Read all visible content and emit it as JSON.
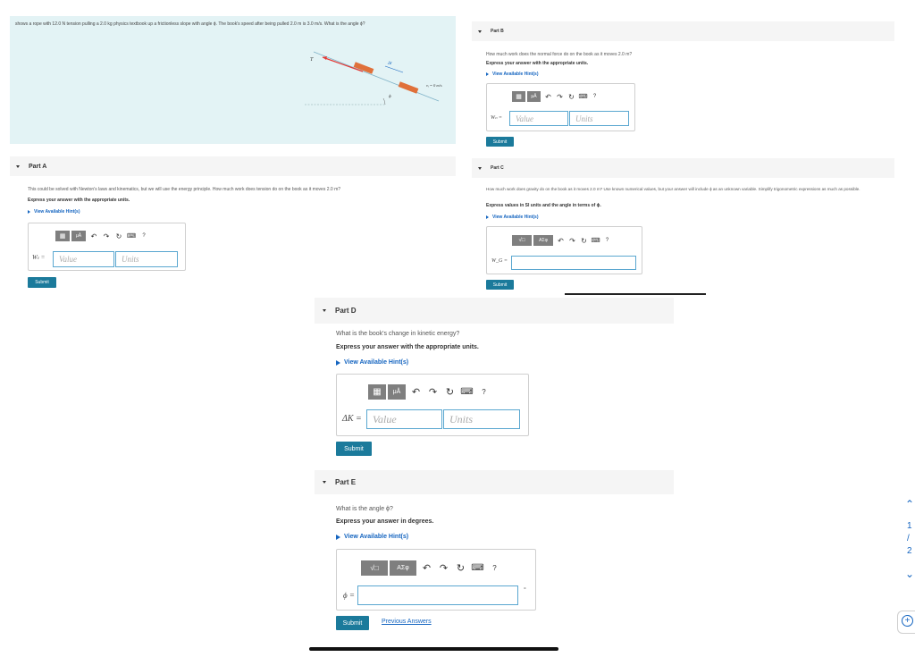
{
  "problem": {
    "text": "shows a rope with 12.0 N tension pulling a 2.0 kg physics textbook up a frictionless slope with angle ϕ. The book's speed after being pulled 2.0 m is 3.0 m/s. What is the angle ϕ?",
    "figure": {
      "tension_label": "T⃗",
      "disp_label": "Δr⃗",
      "v_label": "vᵢ = 0 m/s",
      "angle_label": "ϕ"
    },
    "colors": {
      "bg": "#e3f3f5",
      "rope": "#e53935",
      "book": "#e0703a"
    }
  },
  "toolbar": {
    "templates_icon": "templates-icon",
    "mu_label": "μÅ",
    "sqrt_label": "√□",
    "greek_label": "ΑΣφ",
    "undo_icon": "↶",
    "redo_icon": "↷",
    "reset_icon": "↻",
    "keyboard_icon": "⌨",
    "help_label": "?"
  },
  "parts": {
    "a": {
      "title": "Part A",
      "question": "This could be solved with Newton's laws and kinematics, but we will use the energy principle. How much work does tension do on the book as it moves 2.0 m?",
      "instruction": "Express your answer with the appropriate units.",
      "hint": "View Available Hint(s)",
      "var": "Wₜ =",
      "value_placeholder": "Value",
      "units_placeholder": "Units",
      "submit": "Submit"
    },
    "b": {
      "title": "Part B",
      "question": "How much work does the normal force do on the book as it moves 2.0 m?",
      "instruction": "Express your answer with the appropriate units.",
      "hint": "View Available Hint(s)",
      "var": "Wₙ =",
      "value_placeholder": "Value",
      "units_placeholder": "Units",
      "submit": "Submit"
    },
    "c": {
      "title": "Part C",
      "question": "How much work does gravity do on the book as it moves 2.0 m? Use known numerical values, but your answer will include ϕ as an unknown variable. Simplify trigonometric expressions as much as possible.",
      "instruction": "Express values in SI units and the angle in terms of ϕ.",
      "hint": "View Available Hint(s)",
      "var": "W_G =",
      "submit": "Submit"
    },
    "d": {
      "title": "Part D",
      "question": "What is the book's change in kinetic energy?",
      "instruction": "Express your answer with the appropriate units.",
      "hint": "View Available Hint(s)",
      "var": "ΔK =",
      "value_placeholder": "Value",
      "units_placeholder": "Units",
      "submit": "Submit"
    },
    "e": {
      "title": "Part E",
      "question": "What is the angle ϕ?",
      "instruction": "Express your answer in degrees.",
      "hint": "View Available Hint(s)",
      "var": "ϕ =",
      "unit": "°",
      "submit": "Submit",
      "previous": "Previous Answers"
    }
  },
  "pager": {
    "current": "1",
    "sep": "/",
    "total": "2",
    "up_icon": "chevron-up-icon",
    "down_icon": "chevron-down-icon",
    "zoom_icon": "zoom-in-icon"
  }
}
